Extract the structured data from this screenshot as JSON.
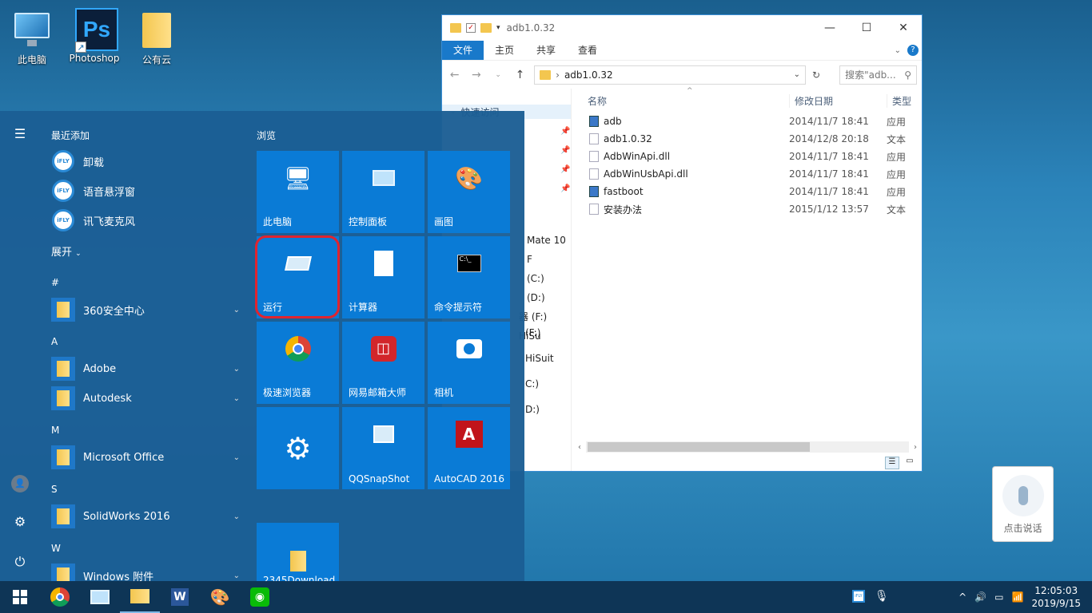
{
  "desktop": {
    "icons": [
      {
        "label": "此电脑"
      },
      {
        "label": "Photoshop",
        "glyph": "Ps"
      },
      {
        "label": "公有云"
      }
    ]
  },
  "explorer": {
    "title": "adb1.0.32",
    "ribbon_tabs": [
      "文件",
      "主页",
      "共享",
      "查看"
    ],
    "address": "adb1.0.32",
    "search_placeholder": "搜索\"adb...",
    "nav_items": [
      "快速访问",
      "Mate 10 F",
      "(C:)",
      "(D:)",
      "器 (F:) HiSu",
      "(F:) HiSuit",
      "C:)",
      "D:)"
    ],
    "columns": [
      "名称",
      "修改日期",
      "类型"
    ],
    "files": [
      {
        "name": "adb",
        "date": "2014/11/7 18:41",
        "type": "应用",
        "kind": "app"
      },
      {
        "name": "adb1.0.32",
        "date": "2014/12/8 20:18",
        "type": "文本",
        "kind": "doc"
      },
      {
        "name": "AdbWinApi.dll",
        "date": "2014/11/7 18:41",
        "type": "应用",
        "kind": "dll"
      },
      {
        "name": "AdbWinUsbApi.dll",
        "date": "2014/11/7 18:41",
        "type": "应用",
        "kind": "dll"
      },
      {
        "name": "fastboot",
        "date": "2014/11/7 18:41",
        "type": "应用",
        "kind": "app"
      },
      {
        "name": "安装办法",
        "date": "2015/1/12 13:57",
        "type": "文本",
        "kind": "doc"
      }
    ]
  },
  "start_menu": {
    "recent_title": "最近添加",
    "recent_apps": [
      "卸载",
      "语音悬浮窗",
      "讯飞麦克风"
    ],
    "expand_label": "展开",
    "groups": [
      {
        "letter": "#",
        "apps": [
          "360安全中心"
        ]
      },
      {
        "letter": "A",
        "apps": [
          "Adobe",
          "Autodesk"
        ]
      },
      {
        "letter": "M",
        "apps": [
          "Microsoft Office"
        ]
      },
      {
        "letter": "S",
        "apps": [
          "SolidWorks 2016"
        ]
      },
      {
        "letter": "W",
        "apps": [
          "Windows 附件"
        ]
      }
    ],
    "tiles_title": "浏览",
    "tiles": [
      {
        "label": "此电脑"
      },
      {
        "label": "控制面板"
      },
      {
        "label": "画图"
      },
      {
        "label": "运行"
      },
      {
        "label": "计算器"
      },
      {
        "label": "命令提示符"
      },
      {
        "label": "极速浏览器"
      },
      {
        "label": "网易邮箱大师"
      },
      {
        "label": "相机"
      },
      {
        "label": ""
      },
      {
        "label": "QQSnapShot"
      },
      {
        "label": "AutoCAD 2016"
      },
      {
        "label": "2345Download"
      }
    ],
    "accent": "#0a7bd6",
    "highlight_color": "#e0242f"
  },
  "voice_widget": {
    "label": "点击说话"
  },
  "taskbar": {
    "time": "12:05:03",
    "date": "2019/9/15",
    "ime": "iFLY"
  }
}
